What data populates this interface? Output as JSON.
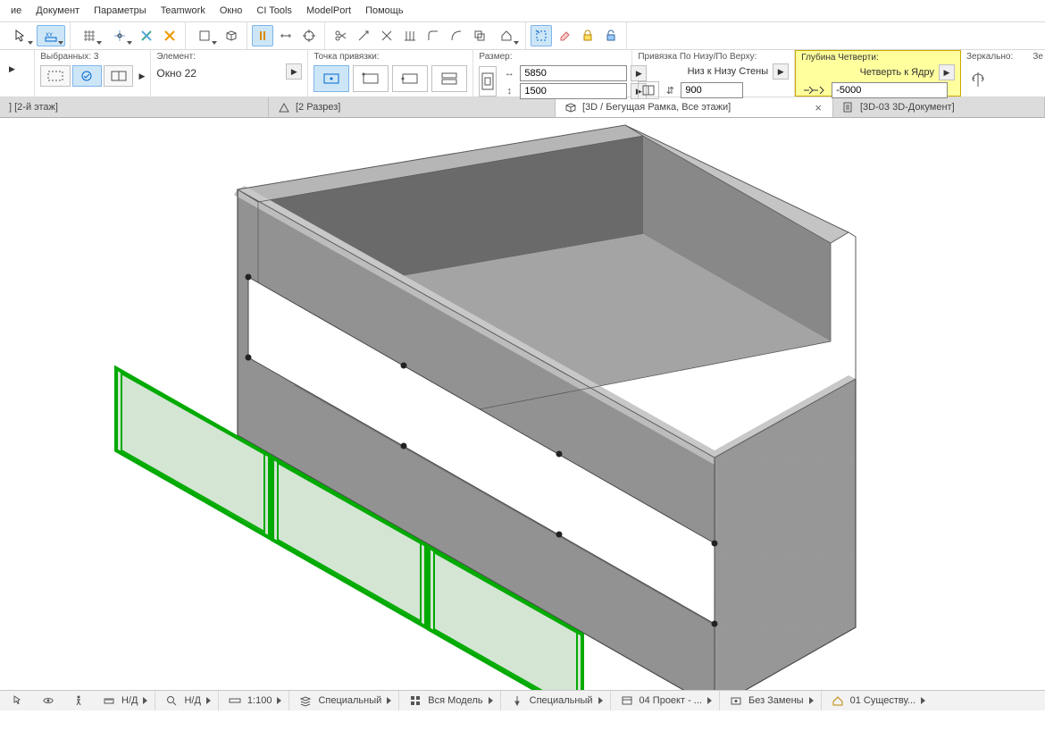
{
  "menu": {
    "items": [
      "ие",
      "Документ",
      "Параметры",
      "Teamwork",
      "Окно",
      "CI Tools",
      "ModelPort",
      "Помощь"
    ]
  },
  "selection": {
    "label": "Выбранных: 3",
    "element_label": "Элемент:",
    "element_name": "Окно 22"
  },
  "anchor": {
    "label": "Точка привязки:"
  },
  "size": {
    "label": "Размер:",
    "width": "5850",
    "height": "1500"
  },
  "bind": {
    "label": "Привязка По Низу/По Верху:",
    "caption": "Низ к Низу Стены",
    "value": "900"
  },
  "depth": {
    "label": "Глубина Четверти:",
    "caption": "Четверть к Ядру",
    "value": "-5000"
  },
  "mirror": {
    "label": "Зеркально:",
    "cut": "Зе"
  },
  "tabs": {
    "t1": "] [2-й этаж]",
    "t2": "[2 Разрез]",
    "t3": "[3D / Бегущая Рамка, Все этажи]",
    "t4": "[3D-03 3D-Документ]"
  },
  "status": {
    "nd1": "Н/Д",
    "nd2": "Н/Д",
    "scale": "1:100",
    "special1": "Специальный",
    "model": "Вся Модель",
    "special2": "Специальный",
    "project": "04 Проект - ...",
    "noreplace": "Без Замены",
    "exist": "01 Существу..."
  }
}
